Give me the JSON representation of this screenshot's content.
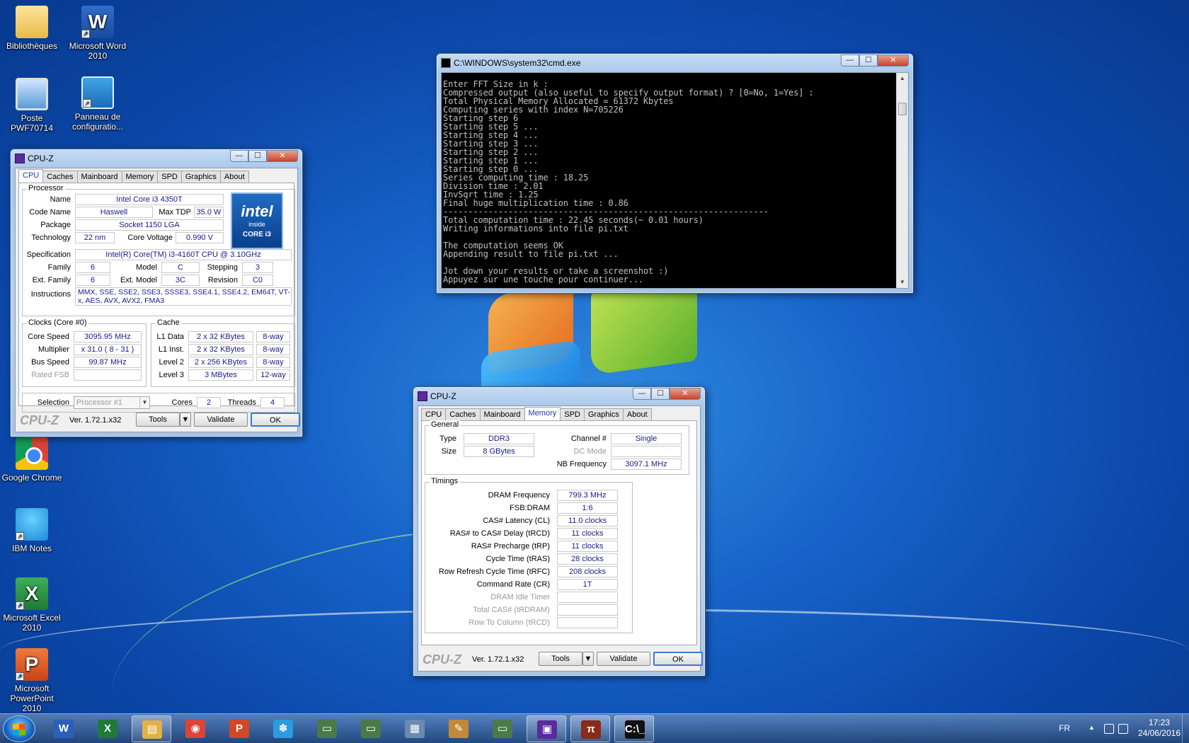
{
  "desktop": {
    "icons": [
      {
        "label": "Bibliothèques",
        "icon": "folder-icon"
      },
      {
        "label": "Microsoft Word 2010",
        "icon": "word-icon"
      },
      {
        "label": "Poste PWF70714",
        "icon": "computer-icon"
      },
      {
        "label": "Panneau de configuratio...",
        "icon": "control-panel-icon"
      },
      {
        "label": "Google Chrome",
        "icon": "chrome-icon"
      },
      {
        "label": "IBM Notes",
        "icon": "ibm-notes-icon"
      },
      {
        "label": "Microsoft Excel 2010",
        "icon": "excel-icon"
      },
      {
        "label": "Microsoft PowerPoint 2010",
        "icon": "powerpoint-icon"
      }
    ]
  },
  "window_controls": {
    "minimize": "—",
    "maximize": "☐",
    "close": "✕"
  },
  "cmd": {
    "title": "C:\\WINDOWS\\system32\\cmd.exe",
    "lines": [
      "Enter FFT Size in k :",
      "Compressed output (also useful to specify output format) ? [0=No, 1=Yes] :",
      "Total Physical Memory Allocated = 61372 Kbytes",
      "Computing series with index N=705226",
      "Starting step 6",
      "Starting step 5 ...",
      "Starting step 4 ...",
      "Starting step 3 ...",
      "Starting step 2 ...",
      "Starting step 1 ...",
      "Starting step 0 ...",
      "Series computing time : 18.25",
      "Division time : 2.01",
      "InvSqrt time : 1.25",
      "Final huge multiplication time : 0.86",
      "-----------------------------------------------------------------",
      "Total computation time : 22.45 seconds(~ 0.01 hours)",
      "Writing informations into file pi.txt",
      "",
      "The computation seems OK",
      "Appending result to file pi.txt ...",
      "",
      "Jot down your results or take a screenshot :)",
      "Appuyez sur une touche pour continuer..."
    ]
  },
  "cpuz1": {
    "title": "CPU-Z",
    "tabs": [
      "CPU",
      "Caches",
      "Mainboard",
      "Memory",
      "SPD",
      "Graphics",
      "About"
    ],
    "active_tab": "CPU",
    "processor_group": "Processor",
    "name_label": "Name",
    "name": "Intel Core i3 4350T",
    "codename_label": "Code Name",
    "codename": "Haswell",
    "maxtdp_label": "Max TDP",
    "maxtdp": "35.0 W",
    "package_label": "Package",
    "package": "Socket 1150 LGA",
    "technology_label": "Technology",
    "technology": "22 nm",
    "corevoltage_label": "Core Voltage",
    "corevoltage": "0.990 V",
    "spec_label": "Specification",
    "spec": "Intel(R) Core(TM) i3-4160T CPU @ 3.10GHz",
    "family_label": "Family",
    "family": "6",
    "model_label": "Model",
    "model": "C",
    "stepping_label": "Stepping",
    "stepping": "3",
    "extfamily_label": "Ext. Family",
    "extfamily": "6",
    "extmodel_label": "Ext. Model",
    "extmodel": "3C",
    "revision_label": "Revision",
    "revision": "C0",
    "instructions_label": "Instructions",
    "instructions": "MMX, SSE, SSE2, SSE3, SSSE3, SSE4.1, SSE4.2, EM64T, VT-x, AES, AVX, AVX2, FMA3",
    "logo": {
      "brand": "intel",
      "inside": "inside",
      "line": "CORE i3"
    },
    "clocks_group": "Clocks (Core #0)",
    "corespeed_label": "Core Speed",
    "corespeed": "3095.95 MHz",
    "multiplier_label": "Multiplier",
    "multiplier": "x 31.0 ( 8 - 31 )",
    "busspeed_label": "Bus Speed",
    "busspeed": "99.87 MHz",
    "ratedfsb_label": "Rated FSB",
    "ratedfsb": "",
    "cache_group": "Cache",
    "l1d_label": "L1 Data",
    "l1d": "2 x 32 KBytes",
    "l1d_way": "8-way",
    "l1i_label": "L1 Inst.",
    "l1i": "2 x 32 KBytes",
    "l1i_way": "8-way",
    "l2_label": "Level 2",
    "l2": "2 x 256 KBytes",
    "l2_way": "8-way",
    "l3_label": "Level 3",
    "l3": "3 MBytes",
    "l3_way": "12-way",
    "selection_label": "Selection",
    "selection": "Processor #1",
    "cores_label": "Cores",
    "cores": "2",
    "threads_label": "Threads",
    "threads": "4"
  },
  "cpuz2": {
    "title": "CPU-Z",
    "tabs": [
      "CPU",
      "Caches",
      "Mainboard",
      "Memory",
      "SPD",
      "Graphics",
      "About"
    ],
    "active_tab": "Memory",
    "general_group": "General",
    "type_label": "Type",
    "type": "DDR3",
    "size_label": "Size",
    "size": "8 GBytes",
    "channel_label": "Channel #",
    "channel": "Single",
    "dcmode_label": "DC Mode",
    "dcmode": "",
    "nbfreq_label": "NB Frequency",
    "nbfreq": "3097.1 MHz",
    "timings_group": "Timings",
    "timings": [
      {
        "label": "DRAM Frequency",
        "value": "799.3 MHz",
        "disabled": false
      },
      {
        "label": "FSB:DRAM",
        "value": "1:6",
        "disabled": false
      },
      {
        "label": "CAS# Latency (CL)",
        "value": "11.0 clocks",
        "disabled": false
      },
      {
        "label": "RAS# to CAS# Delay (tRCD)",
        "value": "11 clocks",
        "disabled": false
      },
      {
        "label": "RAS# Precharge (tRP)",
        "value": "11 clocks",
        "disabled": false
      },
      {
        "label": "Cycle Time (tRAS)",
        "value": "28 clocks",
        "disabled": false
      },
      {
        "label": "Row Refresh Cycle Time (tRFC)",
        "value": "208 clocks",
        "disabled": false
      },
      {
        "label": "Command Rate (CR)",
        "value": "1T",
        "disabled": false
      },
      {
        "label": "DRAM Idle Timer",
        "value": "",
        "disabled": true
      },
      {
        "label": "Total CAS# (tRDRAM)",
        "value": "",
        "disabled": true
      },
      {
        "label": "Row To Column (tRCD)",
        "value": "",
        "disabled": true
      }
    ]
  },
  "cpuz_footer": {
    "brand": "CPU-Z",
    "version": "Ver. 1.72.1.x32",
    "tools": "Tools",
    "validate": "Validate",
    "ok": "OK"
  },
  "taskbar": {
    "apps": [
      {
        "name": "word",
        "glyph": "W",
        "color": "#2b5fb8",
        "open": false
      },
      {
        "name": "excel",
        "glyph": "X",
        "color": "#1f7a3a",
        "open": false
      },
      {
        "name": "explorer",
        "glyph": "▤",
        "color": "#e2b24a",
        "open": true
      },
      {
        "name": "chrome",
        "glyph": "◉",
        "color": "#db4437",
        "open": false
      },
      {
        "name": "powerpoint",
        "glyph": "P",
        "color": "#d24726",
        "open": false
      },
      {
        "name": "ibm-notes",
        "glyph": "✽",
        "color": "#2a9be0",
        "open": false
      },
      {
        "name": "app-window-1",
        "glyph": "▭",
        "color": "#4a7a4a",
        "open": false
      },
      {
        "name": "app-window-2",
        "glyph": "▭",
        "color": "#4a7a4a",
        "open": false
      },
      {
        "name": "calculator",
        "glyph": "▦",
        "color": "#6a8ab0",
        "open": false
      },
      {
        "name": "paint",
        "glyph": "✎",
        "color": "#c08a3a",
        "open": false
      },
      {
        "name": "app-window-3",
        "glyph": "▭",
        "color": "#4a7a4a",
        "open": false
      },
      {
        "name": "cpu-z",
        "glyph": "▣",
        "color": "#5a2a9e",
        "open": true
      },
      {
        "name": "superpi",
        "glyph": "π",
        "color": "#8a2a1a",
        "open": true
      },
      {
        "name": "cmd",
        "glyph": "C:\\_",
        "color": "#111111",
        "open": true
      }
    ],
    "language": "FR",
    "time": "17:23",
    "date": "24/06/2016"
  }
}
